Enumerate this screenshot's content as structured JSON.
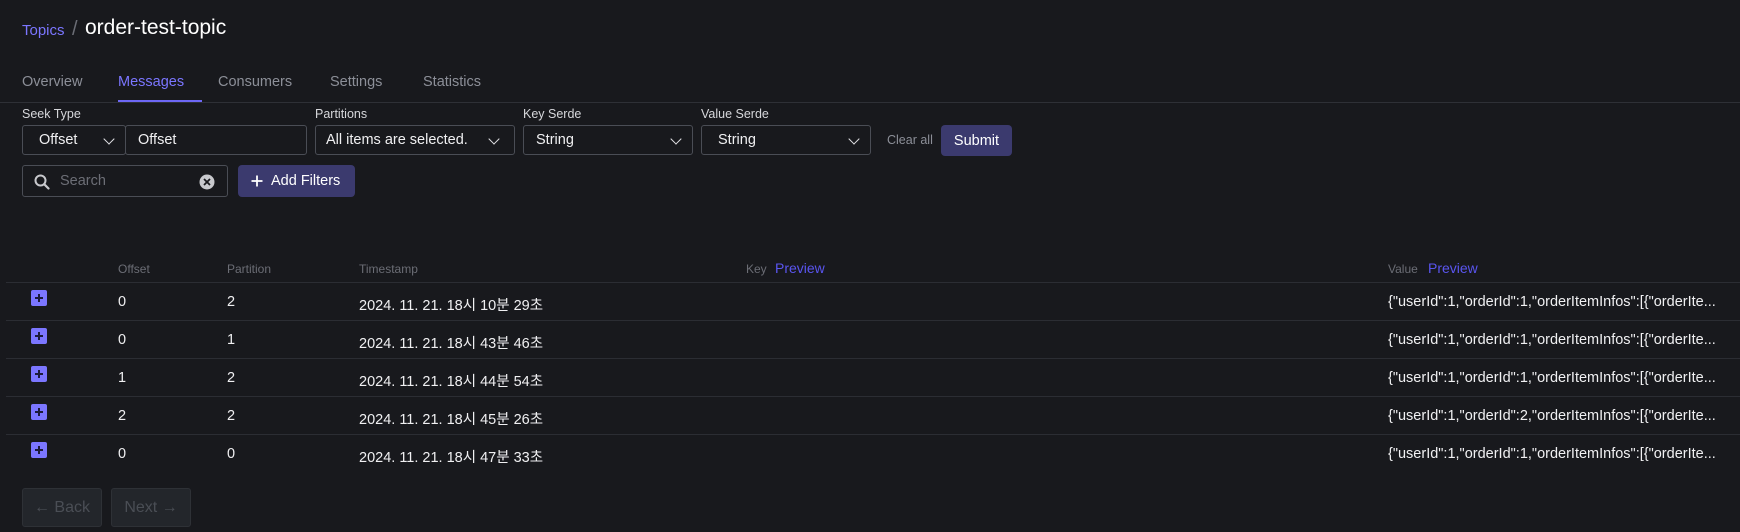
{
  "breadcrumb": {
    "parent": "Topics",
    "separator": "/",
    "title": "order-test-topic"
  },
  "tabs": [
    {
      "label": "Overview"
    },
    {
      "label": "Messages",
      "active": true
    },
    {
      "label": "Consumers"
    },
    {
      "label": "Settings"
    },
    {
      "label": "Statistics"
    }
  ],
  "filters": {
    "seek_type_label": "Seek Type",
    "seek_type_value": "Offset",
    "offset_value": "Offset",
    "partitions_label": "Partitions",
    "partitions_value": "All items are selected.",
    "key_serde_label": "Key Serde",
    "key_serde_value": "String",
    "value_serde_label": "Value Serde",
    "value_serde_value": "String",
    "clear_all": "Clear all",
    "submit": "Submit",
    "search_placeholder": "Search",
    "add_filters": "Add Filters"
  },
  "table": {
    "headers": {
      "offset": "Offset",
      "partition": "Partition",
      "timestamp": "Timestamp",
      "key": "Key",
      "key_preview": "Preview",
      "value": "Value",
      "value_preview": "Preview"
    },
    "rows": [
      {
        "offset": "0",
        "partition": "2",
        "timestamp": "2024. 11. 21. 18시 10분 29초",
        "value": "{\"userId\":1,\"orderId\":1,\"orderItemInfos\":[{\"orderIte..."
      },
      {
        "offset": "0",
        "partition": "1",
        "timestamp": "2024. 11. 21. 18시 43분 46초",
        "value": "{\"userId\":1,\"orderId\":1,\"orderItemInfos\":[{\"orderIte..."
      },
      {
        "offset": "1",
        "partition": "2",
        "timestamp": "2024. 11. 21. 18시 44분 54초",
        "value": "{\"userId\":1,\"orderId\":1,\"orderItemInfos\":[{\"orderIte..."
      },
      {
        "offset": "2",
        "partition": "2",
        "timestamp": "2024. 11. 21. 18시 45분 26초",
        "value": "{\"userId\":1,\"orderId\":2,\"orderItemInfos\":[{\"orderIte..."
      },
      {
        "offset": "0",
        "partition": "0",
        "timestamp": "2024. 11. 21. 18시 47분 33초",
        "value": "{\"userId\":1,\"orderId\":1,\"orderItemInfos\":[{\"orderIte..."
      }
    ]
  },
  "pagination": {
    "back": "← Back",
    "next": "Next →"
  },
  "colors": {
    "accent": "#7b76ff",
    "button_bg": "#3b3a6e",
    "background": "#18191d"
  }
}
